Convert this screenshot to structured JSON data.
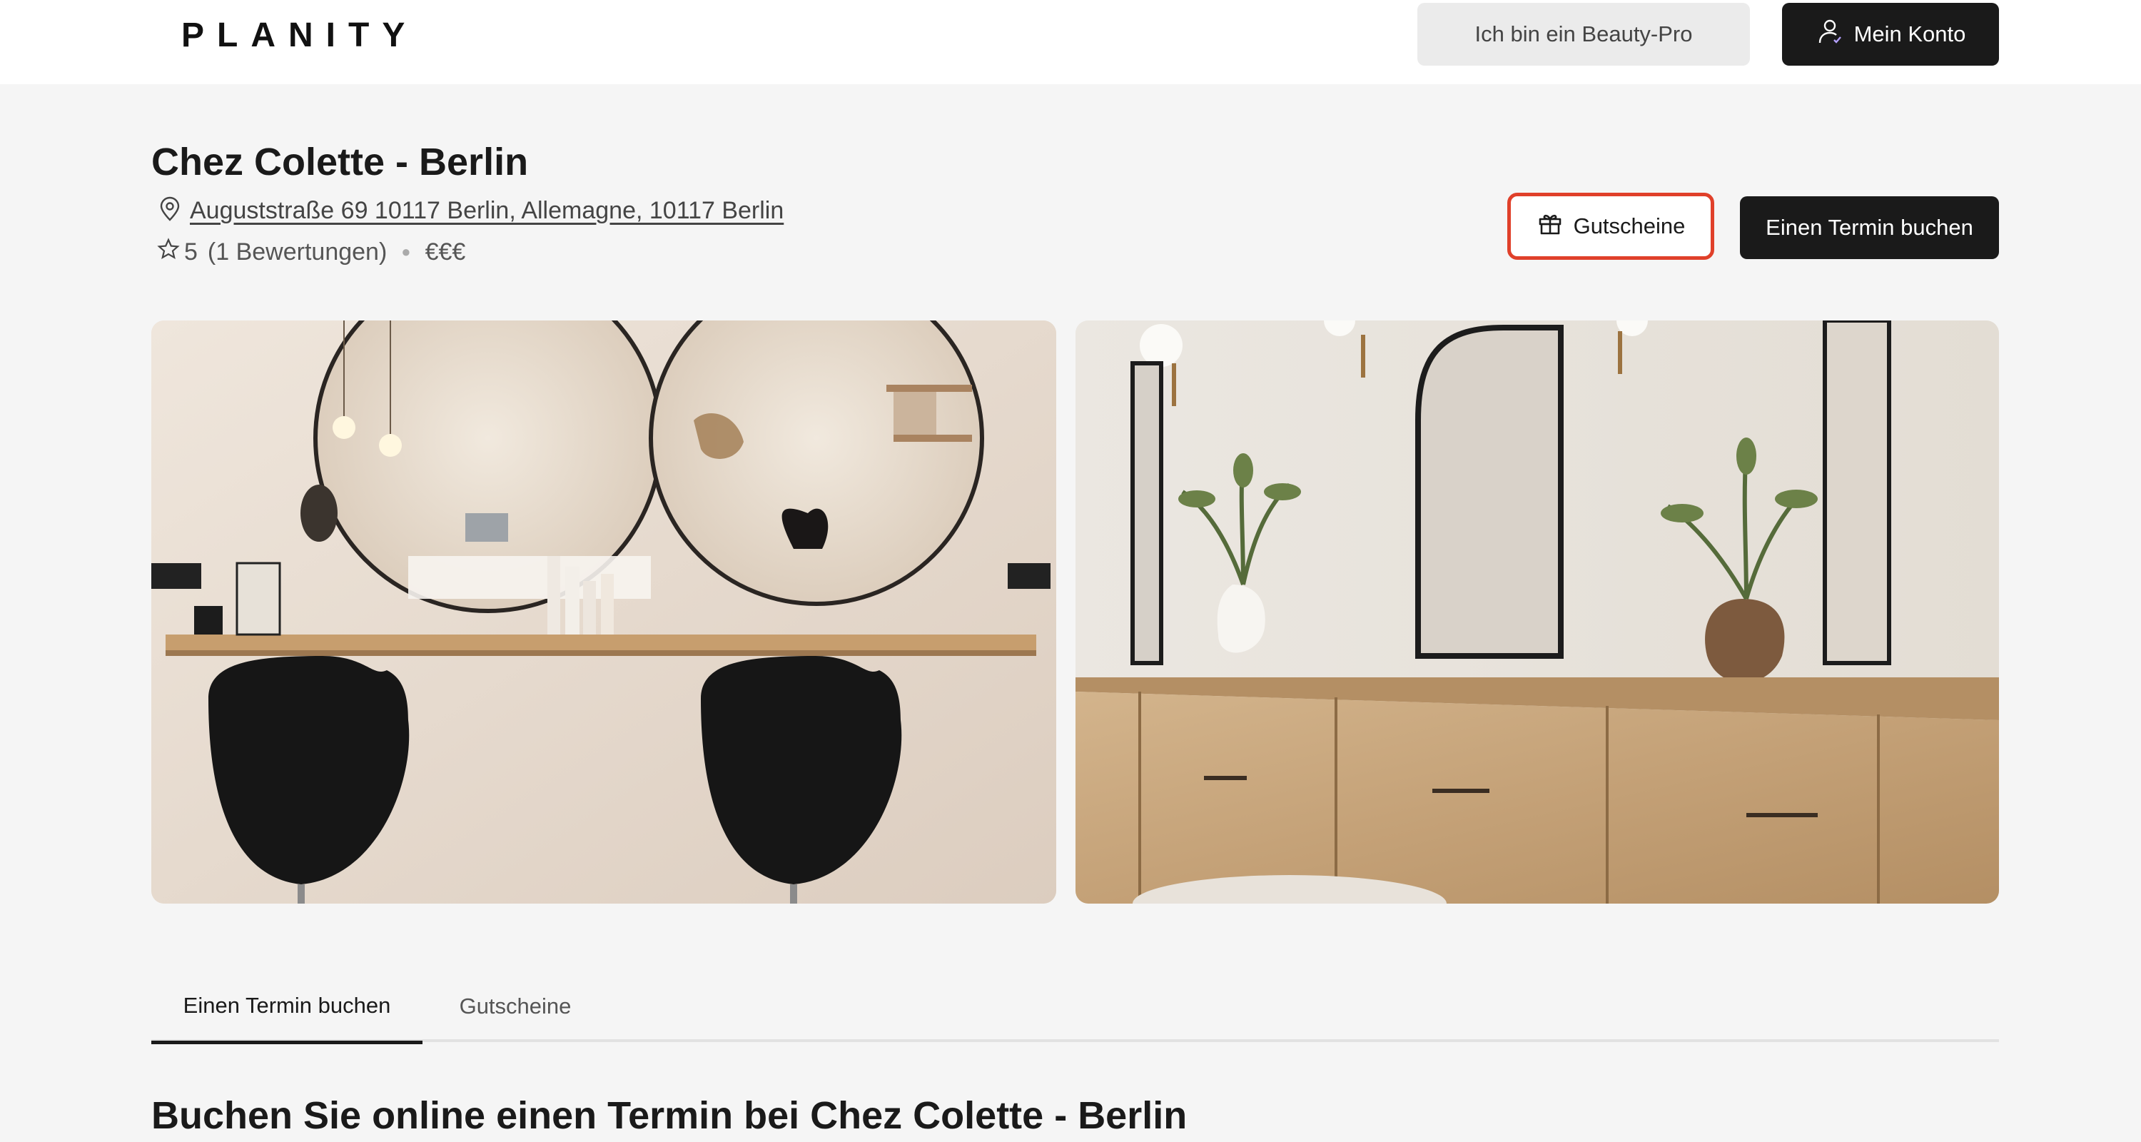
{
  "header": {
    "logo": "PLANITY",
    "pro_label": "Ich bin ein Beauty-Pro",
    "account_label": "Mein Konto"
  },
  "salon": {
    "name": "Chez Colette - Berlin",
    "address": "Auguststraße 69 10117 Berlin, Allemagne, 10117 Berlin",
    "rating": "5",
    "reviews": "(1 Bewertungen)",
    "price": "€€€"
  },
  "actions": {
    "gift_label": "Gutscheine",
    "book_label": "Einen Termin buchen"
  },
  "tabs": [
    {
      "label": "Einen Termin buchen",
      "active": true
    },
    {
      "label": "Gutscheine",
      "active": false
    }
  ],
  "section": {
    "title": "Buchen Sie online einen Termin bei Chez Colette - Berlin"
  },
  "colors": {
    "highlight": "#e0402a",
    "dark": "#1a1a1a",
    "background": "#f5f5f5"
  }
}
